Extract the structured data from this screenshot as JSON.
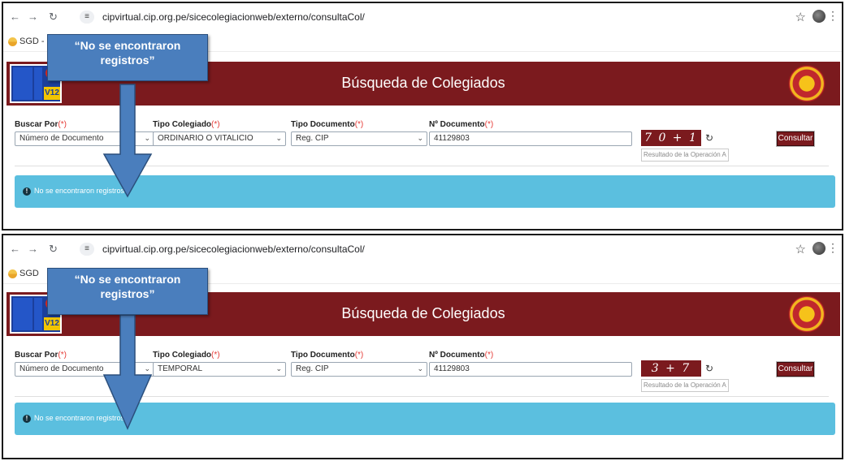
{
  "browser": {
    "url": "cipvirtual.cip.org.pe/sicecolegiacionweb/externo/consultaCol/",
    "bookmark_1": "SGD - S",
    "bookmark_2": "SGD"
  },
  "site": {
    "banner_title": "Búsqueda de Colegiados",
    "logo_text": "V12"
  },
  "form": {
    "buscar_por_label": "Buscar Por",
    "tipo_colegiado_label": "Tipo Colegiado",
    "tipo_documento_label": "Tipo Documento",
    "nro_documento_label": "Nº Documento",
    "required_mark": "(*)",
    "buscar_por_value": "Número de Documento",
    "tipo_documento_value": "Reg. CIP",
    "nro_documento_value": "41129803",
    "captcha_placeholder": "Resultado de la Operación A",
    "consultar_label": "Consultar"
  },
  "panels": [
    {
      "tipo_colegiado_value": "ORDINARIO O VITALICIO",
      "captcha_text": "7 0 + 1"
    },
    {
      "tipo_colegiado_value": "TEMPORAL",
      "captcha_text": "3 + 7"
    }
  ],
  "alert": {
    "message": "No se encontraron registros"
  },
  "annotation": {
    "callout_text": "“No se encontraron registros”"
  },
  "colors": {
    "banner": "#7b1a1e",
    "alert": "#5bbfdf",
    "callout": "#4a7ebd"
  }
}
